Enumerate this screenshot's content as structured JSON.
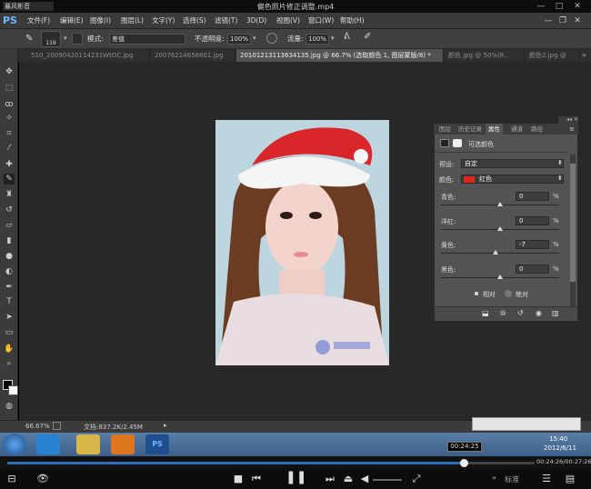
{
  "player": {
    "logo_text": "暴风影音",
    "file_title": "偏色照片修正调整.mp4",
    "win_min": "—",
    "win_max": "□",
    "win_close": "✕",
    "time_tooltip": "00:24:25",
    "time_display": "00:24:26/00:27:26",
    "standard_label": "标准"
  },
  "ps": {
    "logo": "PS",
    "menus": [
      "文件(F)",
      "编辑(E)",
      "图像(I)",
      "图层(L)",
      "文字(Y)",
      "选择(S)",
      "滤镜(T)",
      "3D(D)",
      "视图(V)",
      "窗口(W)",
      "帮助(H)"
    ],
    "options": {
      "brush_size": "119",
      "mode_label": "模式:",
      "mode_value": "差值",
      "opacity_label": "不透明度:",
      "opacity_value": "100%",
      "flow_label": "流量:",
      "flow_value": "100%"
    },
    "tabs": [
      "510_20090420114231WtOC.jpg",
      "20076214658801.jpg",
      "2010121311363413​5.jpg @ 66.7% (选取颜色 1, 图层蒙版/8) *",
      "颜色.jpg @ 50%(R...",
      "颜色2.jpg @"
    ],
    "status": {
      "zoom": "66.67%",
      "doc": "文档:837.2K/2.45M"
    }
  },
  "panel": {
    "tabs": [
      "图层",
      "历史记录",
      "属性",
      "通道",
      "路径"
    ],
    "active_tab": "属性",
    "title": "可选颜色",
    "preset_label": "预设:",
    "preset_value": "自定",
    "color_label": "颜色:",
    "color_value": "红色",
    "color_swatch": "#e0261a",
    "sliders": [
      {
        "label": "青色:",
        "value": "0",
        "unit": "%",
        "pos": 0.5
      },
      {
        "label": "洋红:",
        "value": "0",
        "unit": "%",
        "pos": 0.5
      },
      {
        "label": "黄色:",
        "value": "-7",
        "unit": "%",
        "pos": 0.465
      },
      {
        "label": "黑色:",
        "value": "0",
        "unit": "%",
        "pos": 0.5
      }
    ],
    "method_relative": "相对",
    "method_absolute": "绝对"
  },
  "tray": {
    "time": "15:40",
    "date": "2012/6/11"
  },
  "colors": {
    "ps_accent": "#6fb7ff",
    "progress": "#2d6fbf"
  }
}
